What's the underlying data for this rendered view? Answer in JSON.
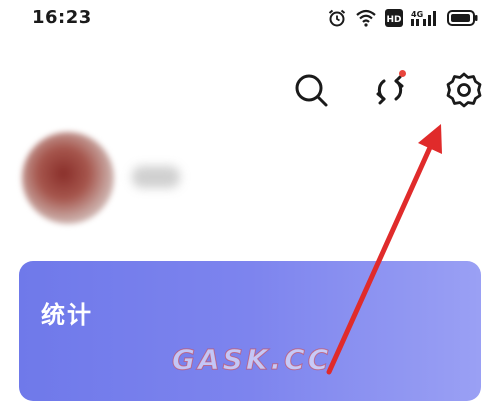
{
  "status_bar": {
    "time": "16:23",
    "icons": [
      "alarm-icon",
      "wifi-icon",
      "hd-icon",
      "4g-signal-icon",
      "battery-icon"
    ],
    "network_label": "4G",
    "hd_label": "HD"
  },
  "toolbar": {
    "buttons": [
      "search-icon",
      "sync-icon",
      "settings-icon"
    ],
    "sync_badge_color": "#e8453c"
  },
  "stats_card": {
    "title": "统计",
    "gradient": [
      "#6f79ea",
      "#9aa0f4"
    ]
  },
  "annotation": {
    "arrow_color": "#e02b2b",
    "points_to": "settings-icon"
  },
  "watermark": "GASK.CC"
}
